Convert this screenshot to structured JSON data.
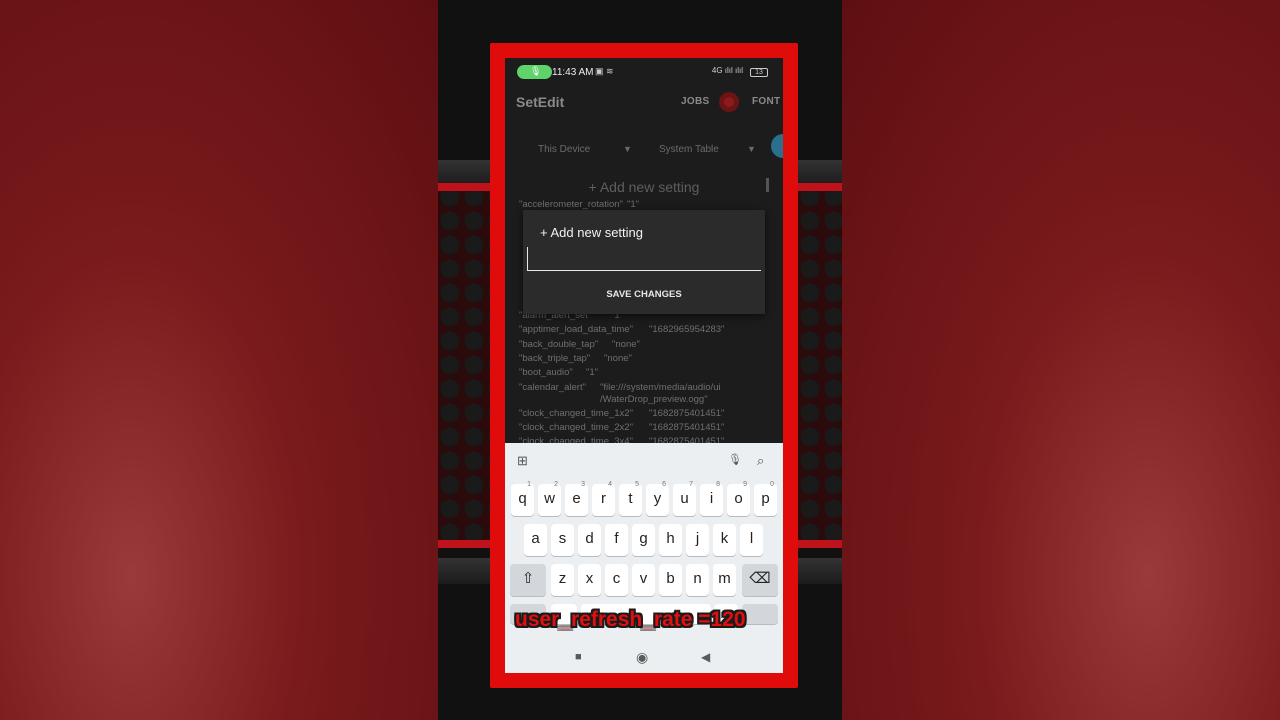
{
  "status_bar": {
    "mic_icon": "mic-icon",
    "time": "11:43 AM",
    "left_icons": "▣ ≋",
    "right_icons": "4G ılıl ılıl",
    "battery": "13"
  },
  "app_bar": {
    "title": "SetEdit",
    "jobs": "JOBS",
    "font": "FONT"
  },
  "filters": {
    "device": "This Device",
    "table": "System Table",
    "arrow": "▼"
  },
  "background_add": "+ Add new setting",
  "settings_rows": [
    {
      "key": "\"accelerometer_rotation\"",
      "value": "\"1\""
    },
    {
      "key": "\"alarm_alert_set\"",
      "value": "\"1\""
    },
    {
      "key": "\"apptimer_load_data_time\"",
      "value": "\"1682965954283\""
    },
    {
      "key": "\"back_double_tap\"",
      "value": "\"none\""
    },
    {
      "key": "\"back_triple_tap\"",
      "value": "\"none\""
    },
    {
      "key": "\"boot_audio\"",
      "value": "\"1\""
    },
    {
      "key": "\"calendar_alert\"",
      "value": "\"file:///system/media/audio/ui"
    },
    {
      "key": "",
      "value": "/WaterDrop_preview.ogg\""
    },
    {
      "key": "\"clock_changed_time_1x2\"",
      "value": "\"1682875401451\""
    },
    {
      "key": "\"clock_changed_time_2x2\"",
      "value": "\"1682875401451\""
    },
    {
      "key": "\"clock_changed_time_3x4\"",
      "value": "\"1682875401451\""
    }
  ],
  "dialog": {
    "title": "+ Add new setting",
    "input_value": "",
    "save_label": "SAVE CHANGES"
  },
  "keyboard": {
    "row1": [
      {
        "k": "q",
        "h": "1"
      },
      {
        "k": "w",
        "h": "2"
      },
      {
        "k": "e",
        "h": "3"
      },
      {
        "k": "r",
        "h": "4"
      },
      {
        "k": "t",
        "h": "5"
      },
      {
        "k": "y",
        "h": "6"
      },
      {
        "k": "u",
        "h": "7"
      },
      {
        "k": "i",
        "h": "8"
      },
      {
        "k": "o",
        "h": "9"
      },
      {
        "k": "p",
        "h": "0"
      }
    ],
    "row2": [
      "a",
      "s",
      "d",
      "f",
      "g",
      "h",
      "j",
      "k",
      "l"
    ],
    "row3": [
      "z",
      "x",
      "c",
      "v",
      "b",
      "n",
      "m"
    ],
    "shift": "⇧",
    "backspace": "⌫",
    "grid": "⊞",
    "mic": "🎙",
    "search": "⌕"
  },
  "caption": "user_refresh_rate =120",
  "navbar": {
    "recent": "■",
    "home": "◉",
    "back": "◀"
  }
}
